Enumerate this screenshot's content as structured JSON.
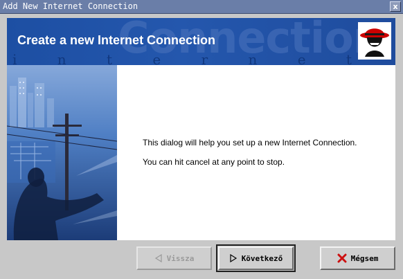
{
  "window": {
    "title": "Add New Internet Connection",
    "close_glyph": "x"
  },
  "banner": {
    "heading": "Create a new Internet Connection",
    "watermark": "Connection",
    "spaced_text": "i n t e r n e t",
    "logo_icon": "redhat-shadowman-logo"
  },
  "content": {
    "line1": "This dialog will help you set up a new Internet Connection.",
    "line2": "You can hit cancel at any point to stop."
  },
  "buttons": {
    "back": {
      "label": "Vissza",
      "icon": "back-triangle-icon",
      "enabled": false
    },
    "next": {
      "label": "Következő",
      "icon": "forward-triangle-icon",
      "enabled": true
    },
    "cancel": {
      "label": "Mégsem",
      "icon": "red-x-icon",
      "enabled": true
    }
  },
  "colors": {
    "titlebar": "#6a7ea8",
    "banner": "#2457ad",
    "cancel_icon": "#cc1010"
  }
}
